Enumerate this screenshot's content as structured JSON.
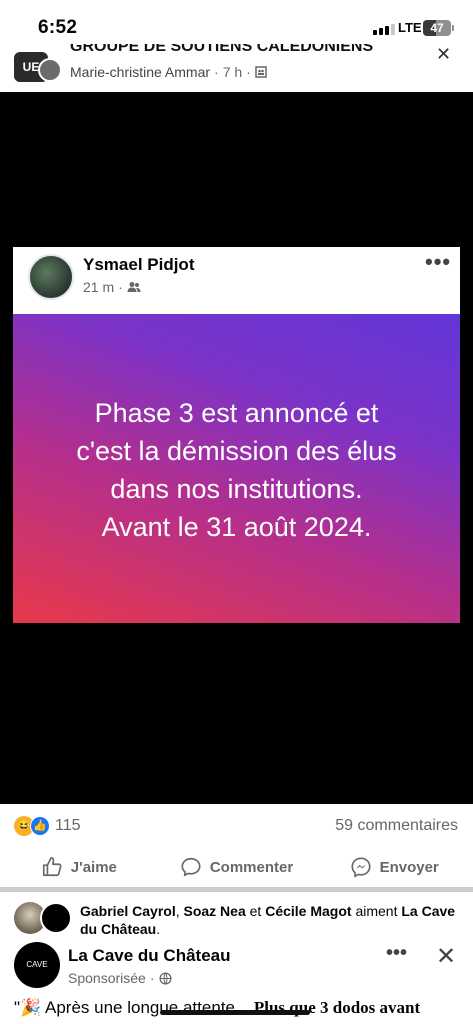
{
  "status_bar": {
    "time": "6:52",
    "network": "LTE",
    "battery": "47",
    "battery_level": 0.47
  },
  "post": {
    "group_name": "GROUPE DE SOUTIENS CALEDONIENS",
    "author": "Marie-christine Ammar",
    "time": "7 h",
    "group_avatar_text": "UE"
  },
  "shared_card": {
    "name": "Ysmael Pidjot",
    "time": "21 m",
    "text_lines": [
      "Phase 3 est annoncé et",
      "c'est la démission des élus",
      "dans nos institutions.",
      "Avant le 31 août 2024."
    ],
    "colors": {
      "start": "#e8394a",
      "mid": "#b32f8e",
      "end": "#6236d8"
    }
  },
  "reactions": {
    "count": "115",
    "comments": "59 commentaires"
  },
  "actions": {
    "like": "J'aime",
    "comment": "Commenter",
    "share": "Envoyer"
  },
  "social_context": {
    "name1": "Gabriel Cayrol",
    "name2": "Soaz Nea",
    "connector": " et ",
    "name3": "Cécile Magot",
    "verb": " aiment ",
    "page": "La Cave du Château",
    "end": "."
  },
  "sponsored": {
    "page_name": "La Cave du Château",
    "label": "Sponsorisée",
    "text_start": "\"🎉 Après une longue attente... ",
    "text_bold": "Plus que 3 dodos avant"
  }
}
